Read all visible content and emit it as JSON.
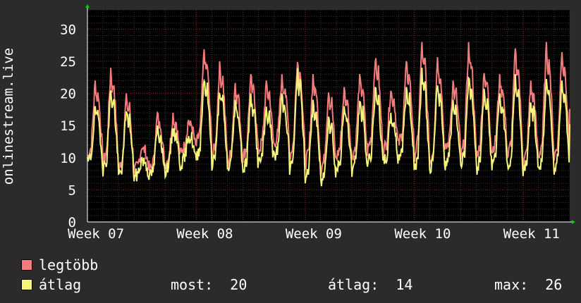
{
  "chart_data": {
    "type": "line",
    "ylabel": "onlinestream.live",
    "ylim": [
      0,
      33
    ],
    "yticks": [
      0,
      5,
      10,
      15,
      20,
      25,
      30
    ],
    "xticks": [
      {
        "label": "Week 07",
        "x": 0
      },
      {
        "label": "Week 08",
        "x": 7
      },
      {
        "label": "Week 09",
        "x": 14
      },
      {
        "label": "Week 10",
        "x": 21
      },
      {
        "label": "Week 11",
        "x": 28
      }
    ],
    "xlim": [
      0,
      31
    ],
    "grid": true,
    "daily_max_peaks": [
      22,
      24,
      20,
      12,
      17,
      17,
      16,
      27,
      25,
      22,
      23,
      22,
      23,
      26,
      23,
      21,
      21,
      23,
      26,
      21,
      25,
      28,
      26,
      22,
      28,
      24,
      23,
      27,
      22,
      28,
      27,
      22
    ],
    "daily_avg_peaks": [
      18,
      21,
      18,
      10,
      15,
      15,
      14,
      23,
      21,
      19,
      20,
      18,
      20,
      24,
      19,
      17,
      18,
      19,
      21,
      17,
      21,
      24,
      22,
      19,
      23,
      21,
      20,
      23,
      19,
      23,
      22,
      19
    ],
    "daily_max_trough": [
      10,
      9,
      8,
      8,
      8,
      9,
      11,
      12,
      10,
      9,
      10,
      11,
      12,
      10,
      9,
      8,
      10,
      10,
      11,
      11,
      12,
      10,
      9,
      11,
      10,
      10,
      11,
      10,
      9,
      10,
      10,
      9
    ],
    "daily_avg_trough": [
      9,
      8,
      7,
      7,
      7,
      8,
      9,
      10,
      9,
      8,
      8,
      9,
      10,
      8,
      7,
      6,
      8,
      8,
      9,
      9,
      10,
      8,
      8,
      9,
      9,
      8,
      9,
      8,
      8,
      8,
      8,
      8
    ],
    "series": [
      {
        "name": "legtöbb",
        "color": "#f47c7c"
      },
      {
        "name": "átlag",
        "color": "#f7f47c"
      }
    ]
  },
  "legend": {
    "max_label": "legtöbb",
    "avg_label": "átlag",
    "most": "most:  20",
    "atlag": "átlag:  14",
    "max": "max:  26"
  },
  "colors": {
    "background": "#2b2b2b",
    "plot_bg": "#000000",
    "grid_minor": "#3a3a3a",
    "grid_major": "#8b2020",
    "axis": "#ffffff",
    "arrow": "#00cc00"
  }
}
